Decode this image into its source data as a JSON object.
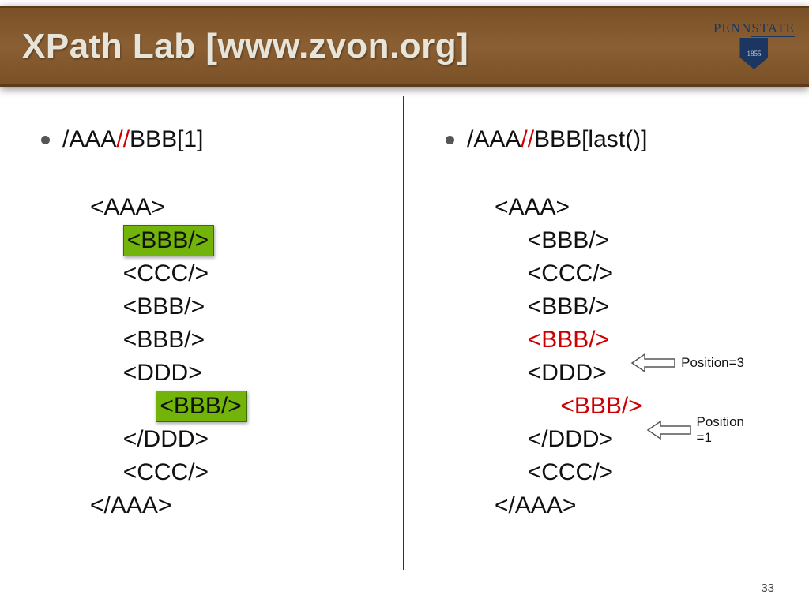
{
  "slide": {
    "title": "XPath Lab [www.zvon.org]",
    "page_number": "33"
  },
  "logo": {
    "text_left": "PENN",
    "text_right": "STATE",
    "year": "1855"
  },
  "left": {
    "xpath_prefix": "/AAA",
    "xpath_sep": "//",
    "xpath_suffix": "BBB[1]",
    "lines": {
      "l0": "<AAA>",
      "l1": "<BBB/>",
      "l2": "<CCC/>",
      "l3": "<BBB/>",
      "l4": "<BBB/>",
      "l5": "<DDD>",
      "l6": "<BBB/>",
      "l7": "</DDD>",
      "l8": "<CCC/>",
      "l9": "</AAA>"
    }
  },
  "right": {
    "xpath_prefix": "/AAA",
    "xpath_sep": "//",
    "xpath_suffix": "BBB[last()]",
    "lines": {
      "l0": "<AAA>",
      "l1": "<BBB/>",
      "l2": "<CCC/>",
      "l3": "<BBB/>",
      "l4": "<BBB/>",
      "l5": "<DDD>",
      "l6": "<BBB/>",
      "l7": "</DDD>",
      "l8": "<CCC/>",
      "l9": "</AAA>"
    },
    "callout1": "Position=3",
    "callout2_a": "Position",
    "callout2_b": "=1"
  }
}
